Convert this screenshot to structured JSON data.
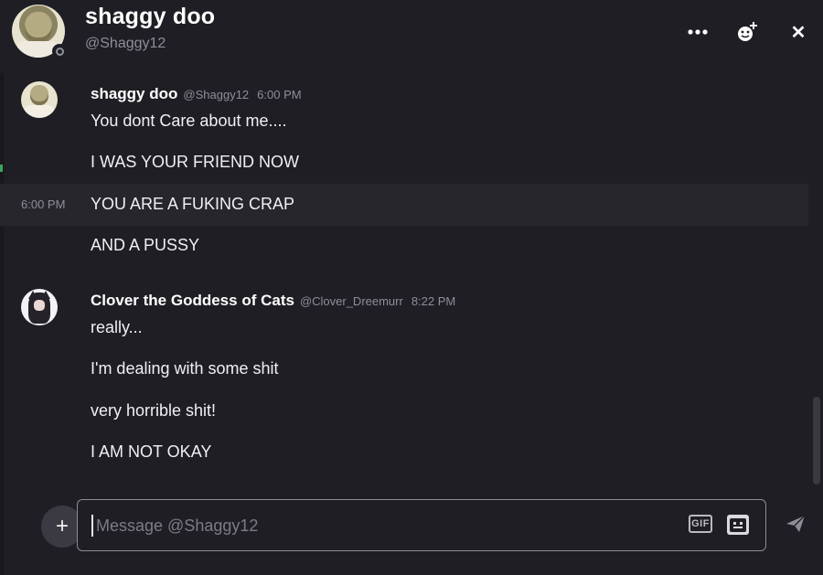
{
  "header": {
    "name": "shaggy doo",
    "handle": "@Shaggy12",
    "icons": [
      "more-icon",
      "add-friend-icon",
      "close-icon"
    ],
    "close_glyph": "✕"
  },
  "messages": [
    {
      "author": "shaggy doo",
      "handle": "@Shaggy12",
      "time": "6:00 PM",
      "hover_time": "6:00 PM",
      "lines": [
        "You dont Care about me....",
        "I WAS YOUR FRIEND NOW",
        "YOU ARE A FUKING CRAP",
        "AND A PUSSY"
      ]
    },
    {
      "author": "Clover the Goddess of Cats",
      "handle": "@Clover_Dreemurr",
      "time": "8:22 PM",
      "lines": [
        "really...",
        "I'm dealing with some shit",
        "very horrible shit!",
        "I AM NOT OKAY"
      ]
    }
  ],
  "composer": {
    "add_label": "+",
    "placeholder": "Message @Shaggy12",
    "value": "",
    "gif_label": "GIF",
    "icons": [
      "sticker-icon",
      "send-icon"
    ]
  },
  "colors": {
    "background": "#1f1e24",
    "hover_row": "#27262c",
    "text": "#f0f0f4",
    "muted": "#8e8e99"
  }
}
